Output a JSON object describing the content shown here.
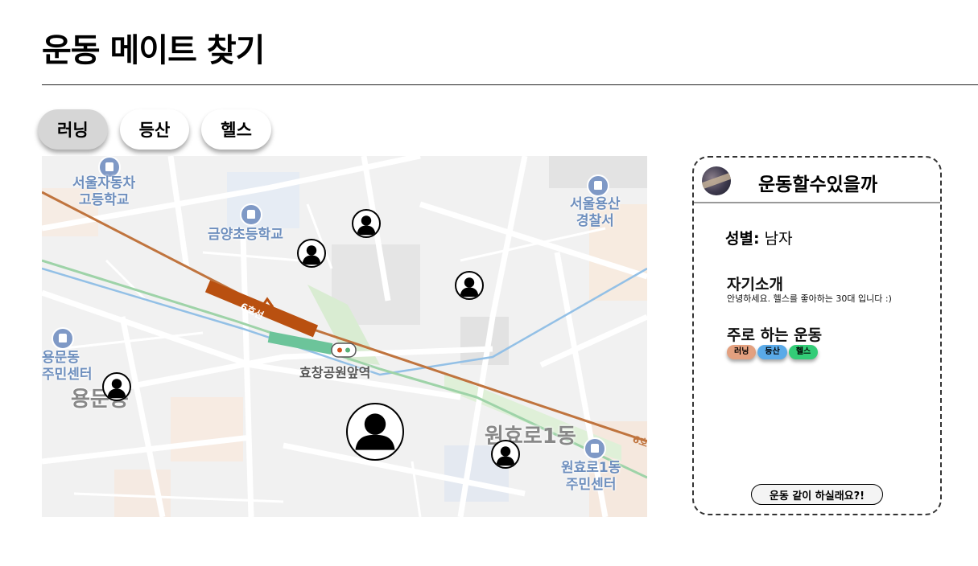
{
  "page": {
    "title": "운동 메이트 찾기"
  },
  "tabs": [
    {
      "label": "러닝",
      "active": true
    },
    {
      "label": "등산",
      "active": false
    },
    {
      "label": "헬스",
      "active": false
    }
  ],
  "map": {
    "labels": {
      "school_1": "서울자동차\n고등학교",
      "school_2": "금양초등학교",
      "police": "서울용산\n경찰서",
      "community_1": "용문동\n주민센터",
      "area_1": "용문동",
      "station": "효창공원앞역",
      "area_2": "원효로1동",
      "community_2": "원효로1동\n주민센터",
      "line_1": "6호선",
      "line_2": "6호"
    }
  },
  "profile": {
    "username": "운동할수있을까",
    "gender_label": "성별:",
    "gender_value": "남자",
    "intro_title": "자기소개",
    "intro_text": "안녕하세요. 헬스를 좋아하는 30대 입니다 :)",
    "sports_title": "주로 하는 운동",
    "sports": [
      {
        "label": "러닝",
        "color": "#e3a07f"
      },
      {
        "label": "등산",
        "color": "#5aaae8"
      },
      {
        "label": "헬스",
        "color": "#33cc77"
      }
    ],
    "invite_button": "운동 같이 하실래요?!"
  }
}
